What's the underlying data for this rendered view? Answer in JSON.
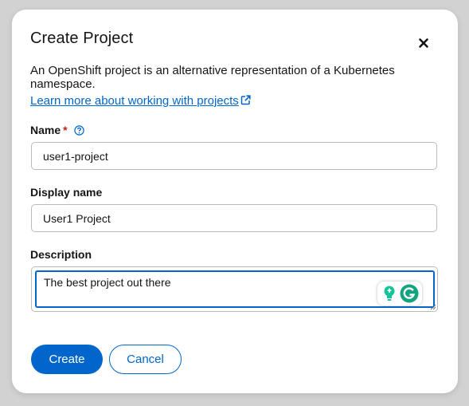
{
  "modal": {
    "title": "Create Project",
    "description": "An OpenShift project is an alternative representation of a Kubernetes namespace.",
    "learn_more_link": "Learn more about working with projects"
  },
  "form": {
    "name_label": "Name",
    "name_required_marker": "*",
    "name_value": "user1-project",
    "display_name_label": "Display name",
    "display_name_value": "User1 Project",
    "description_label": "Description",
    "description_value": "The best project out there"
  },
  "buttons": {
    "create": "Create",
    "cancel": "Cancel"
  },
  "colors": {
    "primary": "#0066cc",
    "required": "#c9190b",
    "grammarly_green": "#15c39a"
  },
  "icons": [
    "close-icon",
    "external-link-icon",
    "help-icon",
    "grammarly-bulb-icon",
    "grammarly-g-icon",
    "resize-handle-icon"
  ]
}
